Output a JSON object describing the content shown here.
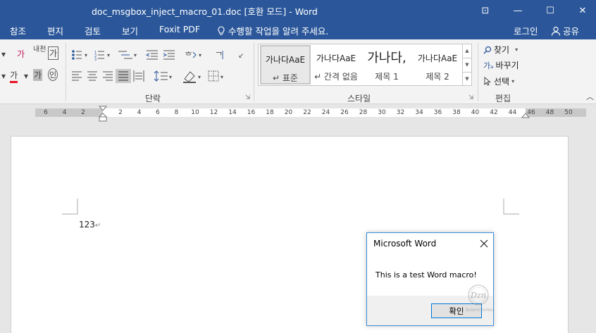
{
  "window": {
    "title": "doc_msgbox_inject_macro_01.doc [호환 모드] - Word",
    "controls": {
      "ribbon_display": "⊡",
      "minimize": "—",
      "maximize": "☐",
      "close": "✕"
    }
  },
  "menu": {
    "tabs": [
      "참조",
      "편지",
      "검토",
      "보기",
      "Foxit PDF"
    ],
    "tell_me": "수행할 작업을 알려 주세요.",
    "login": "로그인",
    "share": "공유"
  },
  "ribbon": {
    "font_group": {
      "glyphs": [
        "가",
        "내천",
        "가",
        "가",
        "가",
        "인"
      ]
    },
    "paragraph": {
      "label": "단락"
    },
    "styles": {
      "label": "스타일",
      "items": [
        {
          "sample": "가나다AaE",
          "name": "↵ 표준",
          "selected": true
        },
        {
          "sample": "가나다AaE",
          "name": "↵ 간격 없음",
          "selected": false
        },
        {
          "sample": "가나다,",
          "name": "제목 1",
          "selected": false
        },
        {
          "sample": "가나다AaE",
          "name": "제목 2",
          "selected": false
        }
      ]
    },
    "editing": {
      "label": "편집",
      "find": "찾기",
      "replace": "바꾸기",
      "select": "선택"
    },
    "collapse": "︿"
  },
  "ruler": {
    "ticks": [
      "6",
      "4",
      "2",
      "2",
      "4",
      "6",
      "8",
      "10",
      "12",
      "14",
      "16",
      "18",
      "20",
      "22",
      "24",
      "26",
      "28",
      "30",
      "32",
      "34",
      "36",
      "38",
      "40",
      "42",
      "44",
      "46",
      "48",
      "50"
    ]
  },
  "document": {
    "text": "123",
    "paragraph_mark": "↵"
  },
  "msgbox": {
    "title": "Microsoft Word",
    "message": "This is a test Word macro!",
    "ok_label": "확인",
    "watermark": "dozenmonkey"
  },
  "colors": {
    "brand": "#2b579a",
    "ribbon_bg": "#f3f3f3",
    "font_color_bar": "#e81123",
    "dialog_border": "#3c8fd8"
  }
}
